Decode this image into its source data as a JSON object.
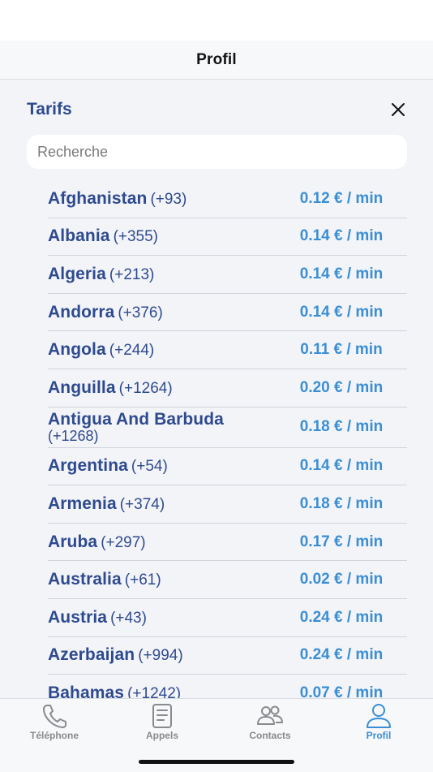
{
  "header": {
    "title": "Profil"
  },
  "tarifs": {
    "title": "Tarifs",
    "search_placeholder": "Recherche",
    "rates": [
      {
        "country": "Afghanistan",
        "code": "(+93)",
        "price": "0.12 € / min"
      },
      {
        "country": "Albania",
        "code": "(+355)",
        "price": "0.14 € / min"
      },
      {
        "country": "Algeria",
        "code": "(+213)",
        "price": "0.14 € / min"
      },
      {
        "country": "Andorra",
        "code": "(+376)",
        "price": "0.14 € / min"
      },
      {
        "country": "Angola",
        "code": "(+244)",
        "price": "0.11 € / min"
      },
      {
        "country": "Anguilla",
        "code": "(+1264)",
        "price": "0.20 € / min"
      },
      {
        "country": "Antigua And Barbuda",
        "code": "(+1268)",
        "price": "0.18 € / min"
      },
      {
        "country": "Argentina",
        "code": "(+54)",
        "price": "0.14 € / min"
      },
      {
        "country": "Armenia",
        "code": "(+374)",
        "price": "0.18 € / min"
      },
      {
        "country": "Aruba",
        "code": "(+297)",
        "price": "0.17 € / min"
      },
      {
        "country": "Australia",
        "code": "(+61)",
        "price": "0.02 € / min"
      },
      {
        "country": "Austria",
        "code": "(+43)",
        "price": "0.24 € / min"
      },
      {
        "country": "Azerbaijan",
        "code": "(+994)",
        "price": "0.24 € / min"
      },
      {
        "country": "Bahamas",
        "code": "(+1242)",
        "price": "0.07 € / min"
      }
    ]
  },
  "tabs": [
    {
      "label": "Téléphone",
      "icon": "phone-icon",
      "active": false
    },
    {
      "label": "Appels",
      "icon": "call-log-icon",
      "active": false
    },
    {
      "label": "Contacts",
      "icon": "contacts-icon",
      "active": false
    },
    {
      "label": "Profil",
      "icon": "profile-icon",
      "active": true
    }
  ],
  "colors": {
    "accent": "#3a8ed4",
    "primary_text": "#2e4a8f",
    "inactive": "#8a8a8e"
  }
}
